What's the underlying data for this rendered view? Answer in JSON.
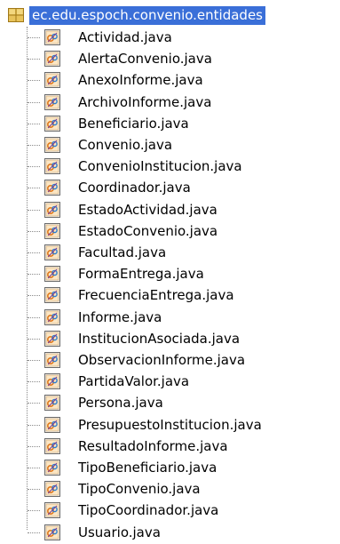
{
  "package": {
    "name": "ec.edu.espoch.convenio.entidades",
    "icon": "package-icon",
    "selected": true
  },
  "files": [
    {
      "name": "Actividad.java"
    },
    {
      "name": "AlertaConvenio.java"
    },
    {
      "name": "AnexoInforme.java"
    },
    {
      "name": "ArchivoInforme.java"
    },
    {
      "name": "Beneficiario.java"
    },
    {
      "name": "Convenio.java"
    },
    {
      "name": "ConvenioInstitucion.java"
    },
    {
      "name": "Coordinador.java"
    },
    {
      "name": "EstadoActividad.java"
    },
    {
      "name": "EstadoConvenio.java"
    },
    {
      "name": "Facultad.java"
    },
    {
      "name": "FormaEntrega.java"
    },
    {
      "name": "FrecuenciaEntrega.java"
    },
    {
      "name": "Informe.java"
    },
    {
      "name": "InstitucionAsociada.java"
    },
    {
      "name": "ObservacionInforme.java"
    },
    {
      "name": "PartidaValor.java"
    },
    {
      "name": "Persona.java"
    },
    {
      "name": "PresupuestoInstitucion.java"
    },
    {
      "name": "ResultadoInforme.java"
    },
    {
      "name": "TipoBeneficiario.java"
    },
    {
      "name": "TipoConvenio.java"
    },
    {
      "name": "TipoCoordinador.java"
    },
    {
      "name": "Usuario.java"
    }
  ],
  "file_icon": "java-file-icon",
  "colors": {
    "selection": "#3a6fd8",
    "selection_text": "#ffffff",
    "icon_orange": "#e07a1f",
    "icon_border": "#6b6b6b"
  }
}
